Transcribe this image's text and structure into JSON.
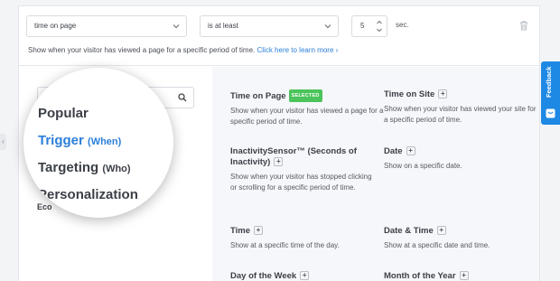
{
  "rule": {
    "type_value": "time on page",
    "comparator_value": "is at least",
    "amount_value": "5",
    "unit": "sec.",
    "hint_text": "Show when your visitor has viewed a page for a specific period of time.",
    "hint_link": "Click here to learn more ›"
  },
  "sidebar": {
    "categories": [
      {
        "label": "Popular",
        "sub": ""
      },
      {
        "label": "Trigger",
        "sub": "(When)"
      },
      {
        "label": "Targeting",
        "sub": "(Who)"
      },
      {
        "label": "Personalization",
        "sub": ""
      }
    ],
    "truncated_item": "Eco"
  },
  "options": [
    {
      "title": "Time on Page",
      "badge": "SELECTED",
      "desc": "Show when your visitor has viewed a page for a specific period of time."
    },
    {
      "title": "Time on Site",
      "desc": "Show when your visitor has viewed your site for a specific period of time."
    },
    {
      "title": "InactivitySensor™ (Seconds of Inactivity)",
      "desc": "Show when your visitor has stopped clicking or scrolling for a specific period of time."
    },
    {
      "title": "Date",
      "desc": "Show on a specific date."
    },
    {
      "title": "Time",
      "desc": "Show at a specific time of the day."
    },
    {
      "title": "Date & Time",
      "desc": "Show at a specific date and time."
    },
    {
      "title": "Day of the Week",
      "desc": ""
    },
    {
      "title": "Month of the Year",
      "desc": ""
    }
  ],
  "feedback_label": "Feedback",
  "colors": {
    "accent": "#2b7fd9",
    "badge": "#4cc45c",
    "feedback": "#1e88e5"
  }
}
